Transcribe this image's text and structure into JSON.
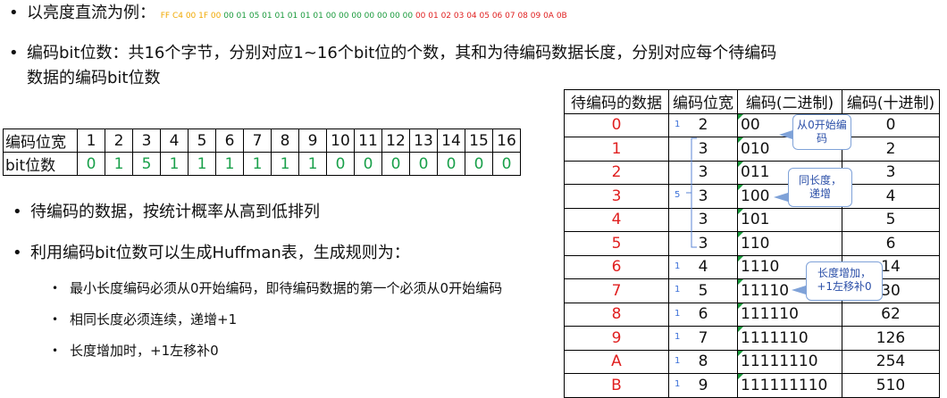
{
  "bullets": {
    "example_label": "以亮度直流为例：",
    "hex_yellow": "FF C4 00 1F 00",
    "hex_green": "00 01 05 01 01 01 01 01 00 00 00 00 00 00 00",
    "hex_red": "00 01 02 03 04 05 06 07 08 09 0A 0B",
    "bitcount_line1": "编码bit位数：共16个字节，分别对应1~16个bit位的个数，其和为待编码数据长度，分别对应每个待编码",
    "bitcount_line2": "数据的编码bit位数",
    "sort": "待编码的数据，按统计概率从高到低排列",
    "gen": "利用编码bit位数可以生成Huffman表，生成规则为：",
    "rules": [
      "最小长度编码必须从0开始编码，即待编码数据的第一个必须从0开始编码",
      "相同长度必须连续，递增+1",
      "长度增加时，+1左移补0"
    ]
  },
  "bit_table": {
    "row1_label": "编码位宽",
    "row2_label": "bit位数",
    "widths": [
      "1",
      "2",
      "3",
      "4",
      "5",
      "6",
      "7",
      "8",
      "9",
      "10",
      "11",
      "12",
      "13",
      "14",
      "15",
      "16"
    ],
    "counts": [
      "0",
      "1",
      "5",
      "1",
      "1",
      "1",
      "1",
      "1",
      "1",
      "0",
      "0",
      "0",
      "0",
      "0",
      "0",
      "0"
    ]
  },
  "huffman_table": {
    "headers": [
      "待编码的数据",
      "编码位宽",
      "编码(二进制)",
      "编码(十进制)"
    ],
    "rows": [
      {
        "sym": "0",
        "width": "2",
        "bin": "00",
        "dec": "0",
        "count": "1"
      },
      {
        "sym": "1",
        "width": "3",
        "bin": "010",
        "dec": "2",
        "count": ""
      },
      {
        "sym": "2",
        "width": "3",
        "bin": "011",
        "dec": "3",
        "count": ""
      },
      {
        "sym": "3",
        "width": "3",
        "bin": "100",
        "dec": "4",
        "count": "5"
      },
      {
        "sym": "4",
        "width": "3",
        "bin": "101",
        "dec": "5",
        "count": ""
      },
      {
        "sym": "5",
        "width": "3",
        "bin": "110",
        "dec": "6",
        "count": ""
      },
      {
        "sym": "6",
        "width": "4",
        "bin": "1110",
        "dec": "14",
        "count": "1"
      },
      {
        "sym": "7",
        "width": "5",
        "bin": "11110",
        "dec": "30",
        "count": "1"
      },
      {
        "sym": "8",
        "width": "6",
        "bin": "111110",
        "dec": "62",
        "count": "1"
      },
      {
        "sym": "9",
        "width": "7",
        "bin": "1111110",
        "dec": "126",
        "count": "1"
      },
      {
        "sym": "A",
        "width": "8",
        "bin": "11111110",
        "dec": "254",
        "count": "1"
      },
      {
        "sym": "B",
        "width": "9",
        "bin": "111111110",
        "dec": "510",
        "count": "1"
      }
    ]
  },
  "callouts": {
    "start": "从0开始编码",
    "same": "同长度，递增",
    "grow": "长度增加，+1左移补0"
  }
}
